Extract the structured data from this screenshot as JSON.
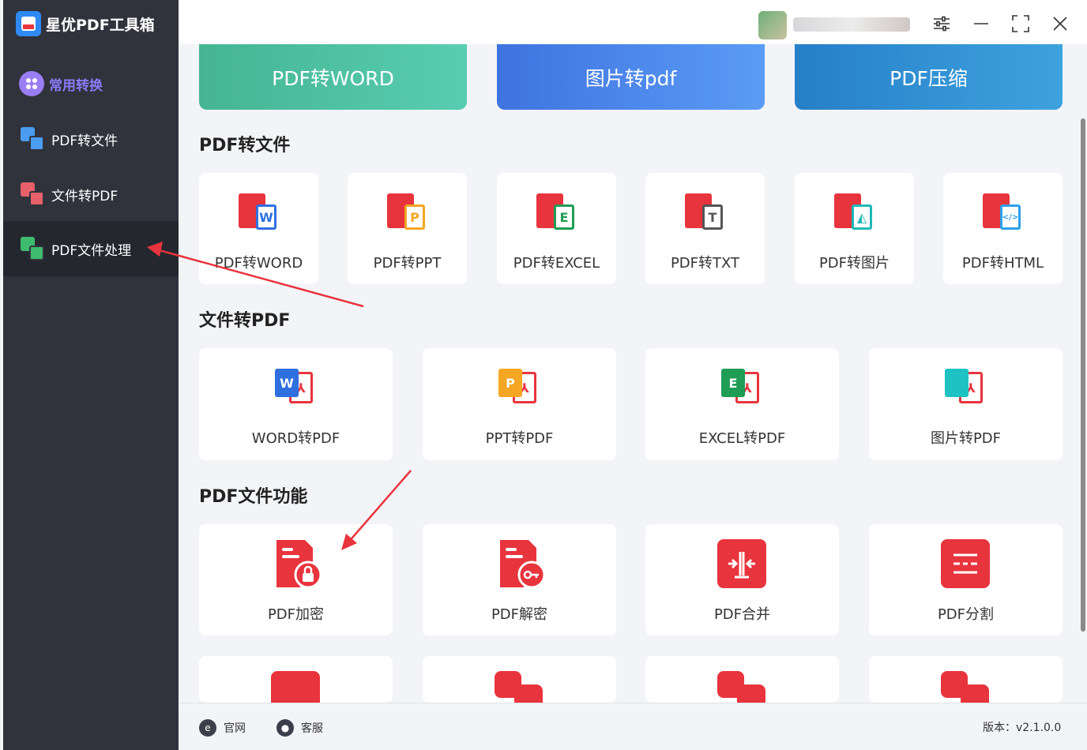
{
  "app": {
    "title": "星优PDF工具箱"
  },
  "sidebar": {
    "items": [
      {
        "label": "常用转换"
      },
      {
        "label": "PDF转文件"
      },
      {
        "label": "文件转PDF"
      },
      {
        "label": "PDF文件处理"
      }
    ]
  },
  "featured": [
    {
      "label": "PDF转WORD"
    },
    {
      "label": "图片转pdf"
    },
    {
      "label": "PDF压缩"
    }
  ],
  "sections": {
    "pdf_to_file": {
      "title": "PDF转文件",
      "items": [
        {
          "label": "PDF转WORD",
          "icon": "pdf-to-word-icon"
        },
        {
          "label": "PDF转PPT",
          "icon": "pdf-to-ppt-icon"
        },
        {
          "label": "PDF转EXCEL",
          "icon": "pdf-to-excel-icon"
        },
        {
          "label": "PDF转TXT",
          "icon": "pdf-to-txt-icon"
        },
        {
          "label": "PDF转图片",
          "icon": "pdf-to-image-icon"
        },
        {
          "label": "PDF转HTML",
          "icon": "pdf-to-html-icon"
        }
      ]
    },
    "file_to_pdf": {
      "title": "文件转PDF",
      "items": [
        {
          "label": "WORD转PDF",
          "icon": "word-to-pdf-icon"
        },
        {
          "label": "PPT转PDF",
          "icon": "ppt-to-pdf-icon"
        },
        {
          "label": "EXCEL转PDF",
          "icon": "excel-to-pdf-icon"
        },
        {
          "label": "图片转PDF",
          "icon": "image-to-pdf-icon"
        }
      ]
    },
    "pdf_functions": {
      "title": "PDF文件功能",
      "items": [
        {
          "label": "PDF加密",
          "icon": "pdf-encrypt-icon"
        },
        {
          "label": "PDF解密",
          "icon": "pdf-decrypt-icon"
        },
        {
          "label": "PDF合并",
          "icon": "pdf-merge-icon"
        },
        {
          "label": "PDF分割",
          "icon": "pdf-split-icon"
        }
      ]
    }
  },
  "footer": {
    "website": "官网",
    "support": "客服",
    "version": "版本：v2.1.0.0"
  },
  "colors": {
    "accent": "#8c7bf7",
    "pdf_red": "#e8343d",
    "card_green": "#4fc0a0",
    "card_blue": "#4a84ea",
    "card_teal": "#2f8fd2"
  }
}
